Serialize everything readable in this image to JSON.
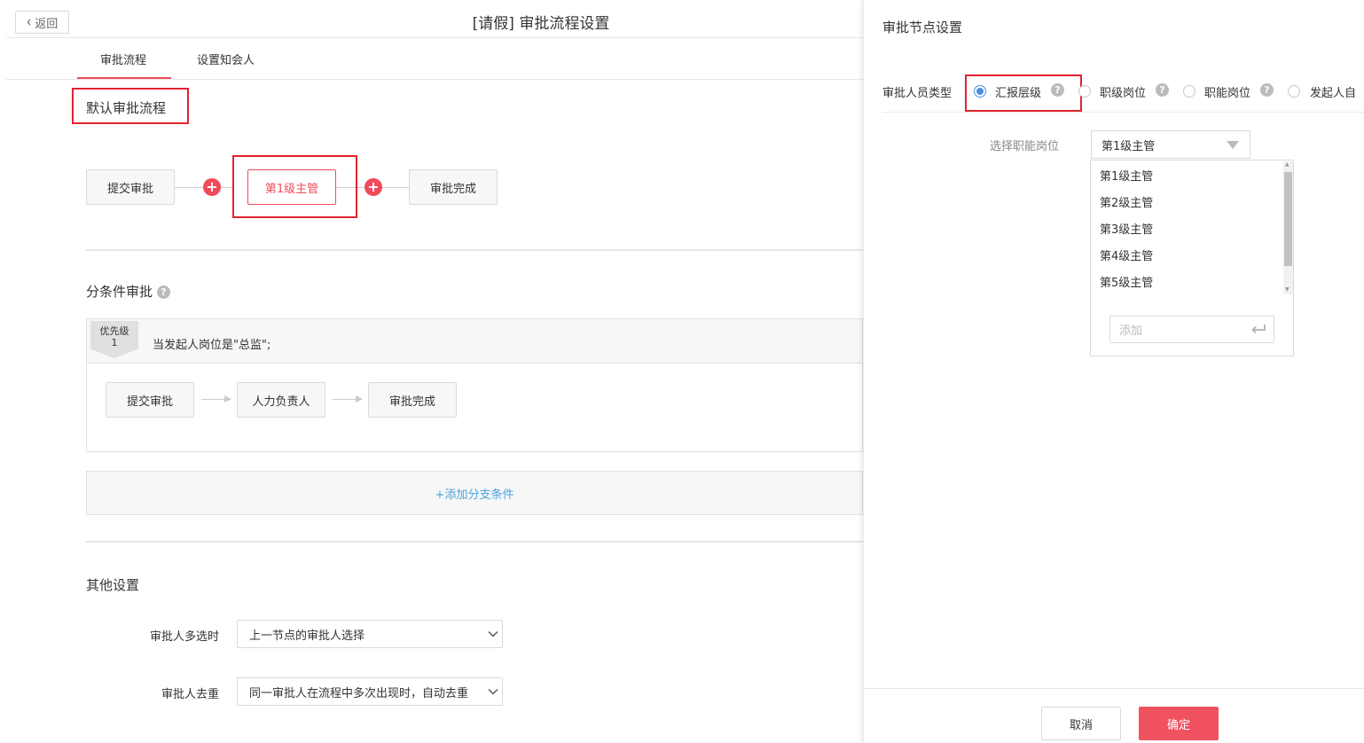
{
  "header": {
    "back_label": "返回",
    "title": "[请假] 审批流程设置"
  },
  "tabs": [
    {
      "label": "审批流程",
      "active": true
    },
    {
      "label": "设置知会人",
      "active": false
    }
  ],
  "default_flow": {
    "title": "默认审批流程",
    "nodes": [
      "提交审批",
      "第1级主管",
      "审批完成"
    ],
    "add_symbol": "+"
  },
  "conditional": {
    "title": "分条件审批",
    "help_symbol": "?",
    "branch": {
      "priority_label": "优先级",
      "priority_value": "1",
      "condition": "当发起人岗位是\"总监\";",
      "nodes": [
        "提交审批",
        "人力负责人",
        "审批完成"
      ]
    },
    "add_branch_label": "+添加分支条件"
  },
  "other_settings": {
    "title": "其他设置",
    "fields": [
      {
        "label": "审批人多选时",
        "value": "上一节点的审批人选择"
      },
      {
        "label": "审批人去重",
        "value": "同一审批人在流程中多次出现时，自动去重"
      }
    ]
  },
  "panel": {
    "title": "审批节点设置",
    "approver_type_label": "审批人员类型",
    "approver_types": [
      {
        "label": "汇报层级",
        "checked": true,
        "help": "?"
      },
      {
        "label": "职级岗位",
        "checked": false,
        "help": "?"
      },
      {
        "label": "职能岗位",
        "checked": false,
        "help": "?"
      },
      {
        "label": "发起人自",
        "checked": false,
        "help": ""
      }
    ],
    "select_label": "选择职能岗位",
    "selected_value": "第1级主管",
    "options": [
      "第1级主管",
      "第2级主管",
      "第3级主管",
      "第4级主管",
      "第5级主管"
    ],
    "add_placeholder": "添加",
    "cancel_label": "取消",
    "ok_label": "确定"
  },
  "colors": {
    "accent": "#f04b5a",
    "highlight_box": "#e2232f",
    "link": "#4aa3df",
    "radio": "#4a8fe3"
  }
}
